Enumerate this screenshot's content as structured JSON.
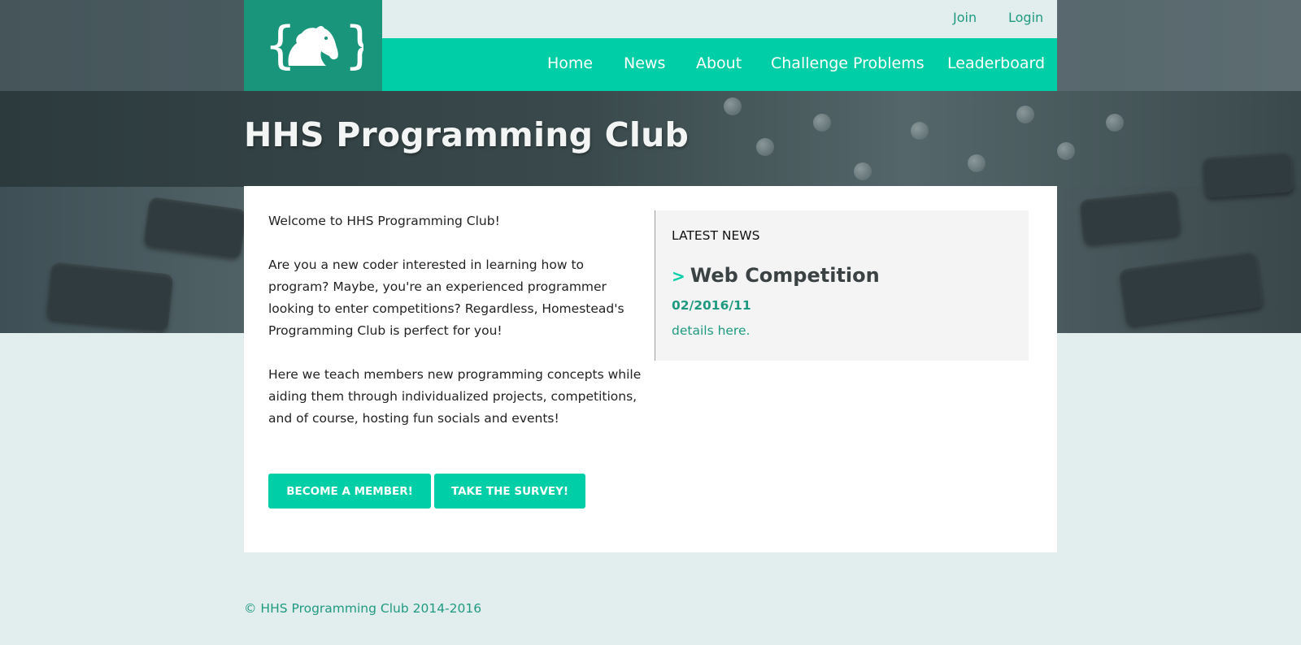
{
  "header": {
    "logo_icon": "horse-in-braces-logo",
    "top_links": [
      {
        "label": "Join"
      },
      {
        "label": "Login"
      }
    ],
    "nav": [
      {
        "label": "Home"
      },
      {
        "label": "News"
      },
      {
        "label": "About"
      },
      {
        "label": "Challenge Problems"
      },
      {
        "label": "Leaderboard"
      }
    ]
  },
  "hero": {
    "title": "HHS Programming Club"
  },
  "main": {
    "paragraphs": [
      "Welcome to HHS Programming Club!",
      "Are you a new coder interested in learning how to program? Maybe, you're an experienced programmer looking to enter competitions? Regardless, Homestead's Programming Club is perfect for you!",
      "Here we teach members new programming concepts while aiding them through individualized projects, competitions, and of course, hosting fun socials and events!"
    ],
    "buttons": [
      {
        "label": "BECOME A MEMBER!"
      },
      {
        "label": "TAKE THE SURVEY!"
      }
    ]
  },
  "news": {
    "heading": "LATEST NEWS",
    "chevron": ">",
    "title": "Web Competition",
    "date": "02/2016/11",
    "link": "details here."
  },
  "footer": {
    "copyright": "© HHS Programming Club 2014-2016"
  },
  "colors": {
    "accent": "#00cea6",
    "logo_bg": "#18957a",
    "link": "#1f9a80",
    "page_bg": "#e2eeee"
  }
}
